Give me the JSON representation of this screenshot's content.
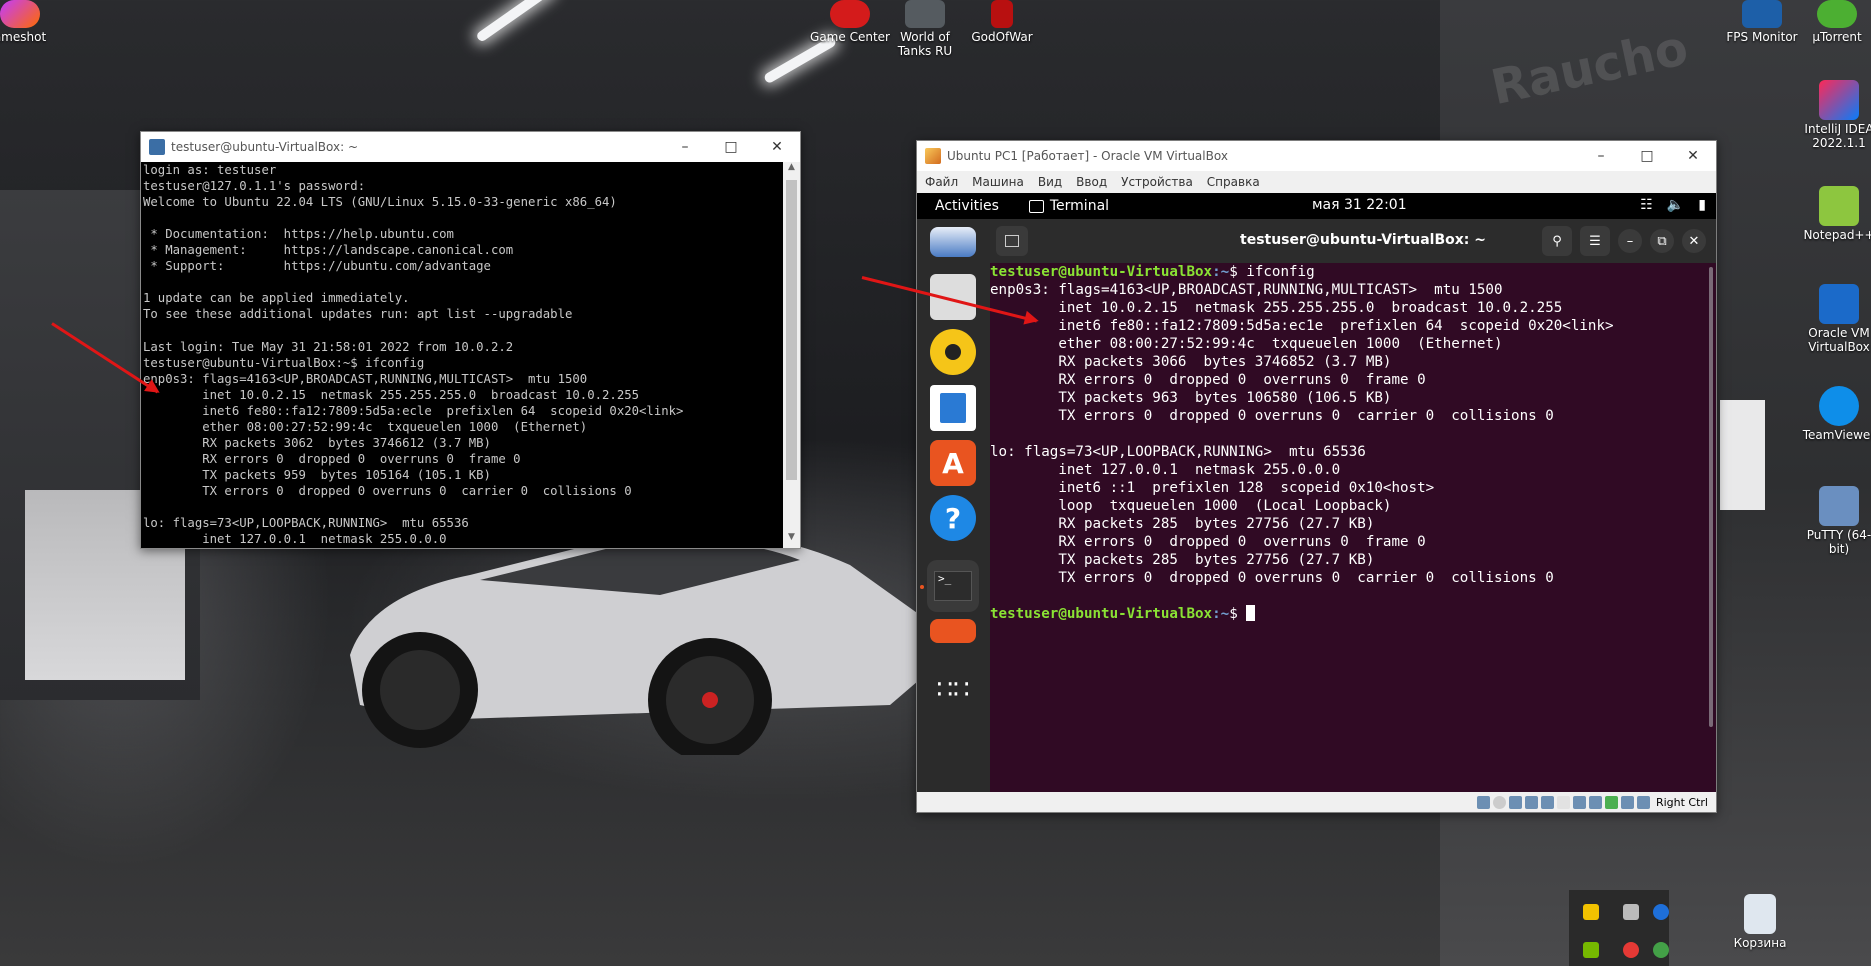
{
  "desktop": {
    "icons": [
      {
        "label": "ameshot",
        "icon": "lightshot-icon"
      },
      {
        "label": "Game Center",
        "icon": "game-center-icon"
      },
      {
        "label": "World of Tanks RU",
        "icon": "world-of-tanks-icon"
      },
      {
        "label": "GodOfWar",
        "icon": "god-of-war-icon"
      },
      {
        "label": "FPS Monitor",
        "icon": "fps-monitor-icon"
      },
      {
        "label": "µTorrent",
        "icon": "utorrent-icon"
      },
      {
        "label": "IntelliJ IDEA 2022.1.1",
        "icon": "intellij-idea-icon"
      },
      {
        "label": "Notepad++",
        "icon": "notepadpp-icon"
      },
      {
        "label": "Oracle VM VirtualBox",
        "icon": "virtualbox-icon"
      },
      {
        "label": "TeamViewer",
        "icon": "teamviewer-icon"
      },
      {
        "label": "PuTTY (64-bit)",
        "icon": "putty-icon"
      },
      {
        "label": "Корзина",
        "icon": "recycle-bin-icon"
      }
    ],
    "wall_sign": "Raucho"
  },
  "putty": {
    "title": "testuser@ubuntu-VirtualBox: ~",
    "lines": [
      "login as: testuser",
      "testuser@127.0.1.1's password:",
      "Welcome to Ubuntu 22.04 LTS (GNU/Linux 5.15.0-33-generic x86_64)",
      "",
      " * Documentation:  https://help.ubuntu.com",
      " * Management:     https://landscape.canonical.com",
      " * Support:        https://ubuntu.com/advantage",
      "",
      "1 update can be applied immediately.",
      "To see these additional updates run: apt list --upgradable",
      "",
      "Last login: Tue May 31 21:58:01 2022 from 10.0.2.2",
      "testuser@ubuntu-VirtualBox:~$ ifconfig",
      "enp0s3: flags=4163<UP,BROADCAST,RUNNING,MULTICAST>  mtu 1500",
      "        inet 10.0.2.15  netmask 255.255.255.0  broadcast 10.0.2.255",
      "        inet6 fe80::fa12:7809:5d5a:ecle  prefixlen 64  scopeid 0x20<link>",
      "        ether 08:00:27:52:99:4c  txqueuelen 1000  (Ethernet)",
      "        RX packets 3062  bytes 3746612 (3.7 MB)",
      "        RX errors 0  dropped 0  overruns 0  frame 0",
      "        TX packets 959  bytes 105164 (105.1 KB)",
      "        TX errors 0  dropped 0 overruns 0  carrier 0  collisions 0",
      "",
      "lo: flags=73<UP,LOOPBACK,RUNNING>  mtu 65536",
      "        inet 127.0.0.1  netmask 255.0.0.0"
    ]
  },
  "vbox": {
    "title": "Ubuntu PC1 [Работает] - Oracle VM VirtualBox",
    "menu": [
      "Файл",
      "Машина",
      "Вид",
      "Ввод",
      "Устройства",
      "Справка"
    ],
    "host_key": "Right Ctrl",
    "gnome": {
      "activities": "Activities",
      "app_name": "Terminal",
      "clock": "мая 31  22:01"
    },
    "terminal": {
      "title": "testuser@ubuntu-VirtualBox: ~",
      "prompt_user": "testuser@ubuntu-VirtualBox",
      "prompt_path": ":~",
      "prompt_sym": "$ ",
      "command": "ifconfig",
      "output": [
        "enp0s3: flags=4163<UP,BROADCAST,RUNNING,MULTICAST>  mtu 1500",
        "        inet 10.0.2.15  netmask 255.255.255.0  broadcast 10.0.2.255",
        "        inet6 fe80::fa12:7809:5d5a:ec1e  prefixlen 64  scopeid 0x20<link>",
        "        ether 08:00:27:52:99:4c  txqueuelen 1000  (Ethernet)",
        "        RX packets 3066  bytes 3746852 (3.7 MB)",
        "        RX errors 0  dropped 0  overruns 0  frame 0",
        "        TX packets 963  bytes 106580 (106.5 KB)",
        "        TX errors 0  dropped 0 overruns 0  carrier 0  collisions 0",
        "",
        "lo: flags=73<UP,LOOPBACK,RUNNING>  mtu 65536",
        "        inet 127.0.0.1  netmask 255.0.0.0",
        "        inet6 ::1  prefixlen 128  scopeid 0x10<host>",
        "        loop  txqueuelen 1000  (Local Loopback)",
        "        RX packets 285  bytes 27756 (27.7 KB)",
        "        RX errors 0  dropped 0  overruns 0  frame 0",
        "        TX packets 285  bytes 27756 (27.7 KB)",
        "        TX errors 0  dropped 0 overruns 0  carrier 0  collisions 0",
        ""
      ]
    }
  },
  "colors": {
    "terminal_bg": "#300a24",
    "prompt_user": "#8ae234",
    "prompt_path": "#729fcf",
    "arrow": "#e01616"
  }
}
